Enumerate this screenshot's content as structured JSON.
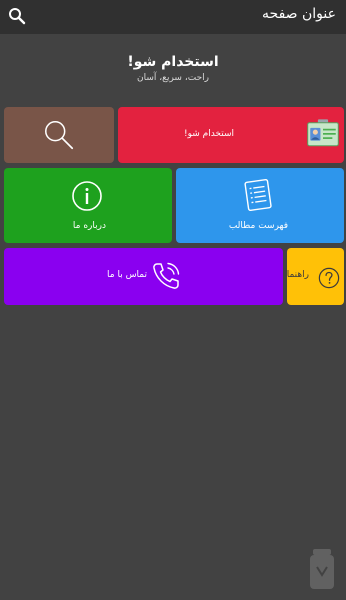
{
  "appbar": {
    "title": "عنوان صفحه",
    "search_icon": "search-icon"
  },
  "hero": {
    "title": "استخدام شو!",
    "subtitle": "راحت، سریع، آسان"
  },
  "tiles": {
    "search": {
      "icon": "magnifier-icon",
      "color": "#795548"
    },
    "hire": {
      "label": "استخدام شو!",
      "icon": "id-card-icon",
      "color": "#e3223f"
    },
    "about": {
      "label": "درباره ما",
      "icon": "info-icon",
      "color": "#1ea11e"
    },
    "contents": {
      "label": "فهرست مطالب",
      "icon": "list-icon",
      "color": "#2e96ec"
    },
    "contact": {
      "label": "تماس با ما",
      "icon": "phone-icon",
      "color": "#8a00f0"
    },
    "help": {
      "label": "راهنما",
      "icon": "question-icon",
      "color": "#ffc107"
    }
  },
  "colors": {
    "background": "#424242",
    "appbar": "#303030"
  }
}
